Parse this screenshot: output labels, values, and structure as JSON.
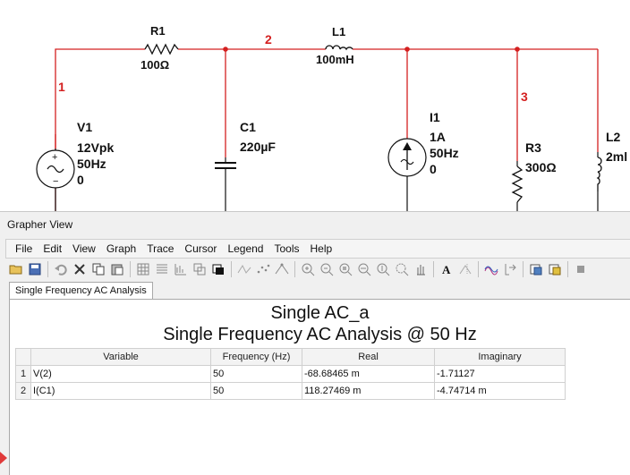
{
  "schematic": {
    "nodes": [
      "1",
      "2",
      "3"
    ],
    "components": {
      "r1": {
        "name": "R1",
        "value": "100Ω"
      },
      "l1": {
        "name": "L1",
        "value": "100mH"
      },
      "c1": {
        "name": "C1",
        "value": "220µF"
      },
      "v1": {
        "name": "V1",
        "line1": "12Vpk",
        "line2": "50Hz",
        "line3": "0"
      },
      "i1": {
        "name": "I1",
        "line1": "1A",
        "line2": "50Hz",
        "line3": "0"
      },
      "r3": {
        "name": "R3",
        "value": "300Ω"
      },
      "l2": {
        "name": "L2",
        "value": "2ml"
      }
    },
    "colors": {
      "wire": "#d42020",
      "component": "#111111",
      "node_label": "#d42020"
    }
  },
  "grapher": {
    "title": "Grapher View",
    "menu": [
      "File",
      "Edit",
      "View",
      "Graph",
      "Trace",
      "Cursor",
      "Legend",
      "Tools",
      "Help"
    ],
    "toolbar_icons": [
      "open-icon",
      "save-icon",
      "undo-icon",
      "delete-icon",
      "copy-icon",
      "paste-icon",
      "grid-icon",
      "list-icon",
      "plot-icon",
      "overlay-icon",
      "window-icon",
      "waveform-icon",
      "points-icon",
      "peak-icon",
      "zoom-in-icon",
      "zoom-out-icon",
      "zoom-fit-icon",
      "zoom-x-icon",
      "zoom-y-icon",
      "zoom-area-icon",
      "pan-icon",
      "text-icon",
      "cursor-icon",
      "trace-icon",
      "export-icon",
      "print-icon",
      "settings-icon",
      "stop-icon"
    ],
    "tab": "Single Frequency AC Analysis",
    "heading1": "Single AC_a",
    "heading2": "Single Frequency AC Analysis @ 50 Hz",
    "columns": [
      "Variable",
      "Frequency (Hz)",
      "Real",
      "Imaginary"
    ],
    "rows": [
      {
        "num": "1",
        "variable": "V(2)",
        "frequency": "50",
        "real": "-68.68465 m",
        "imag": "-1.71127"
      },
      {
        "num": "2",
        "variable": "I(C1)",
        "frequency": "50",
        "real": "118.27469 m",
        "imag": "-4.74714 m"
      }
    ]
  }
}
